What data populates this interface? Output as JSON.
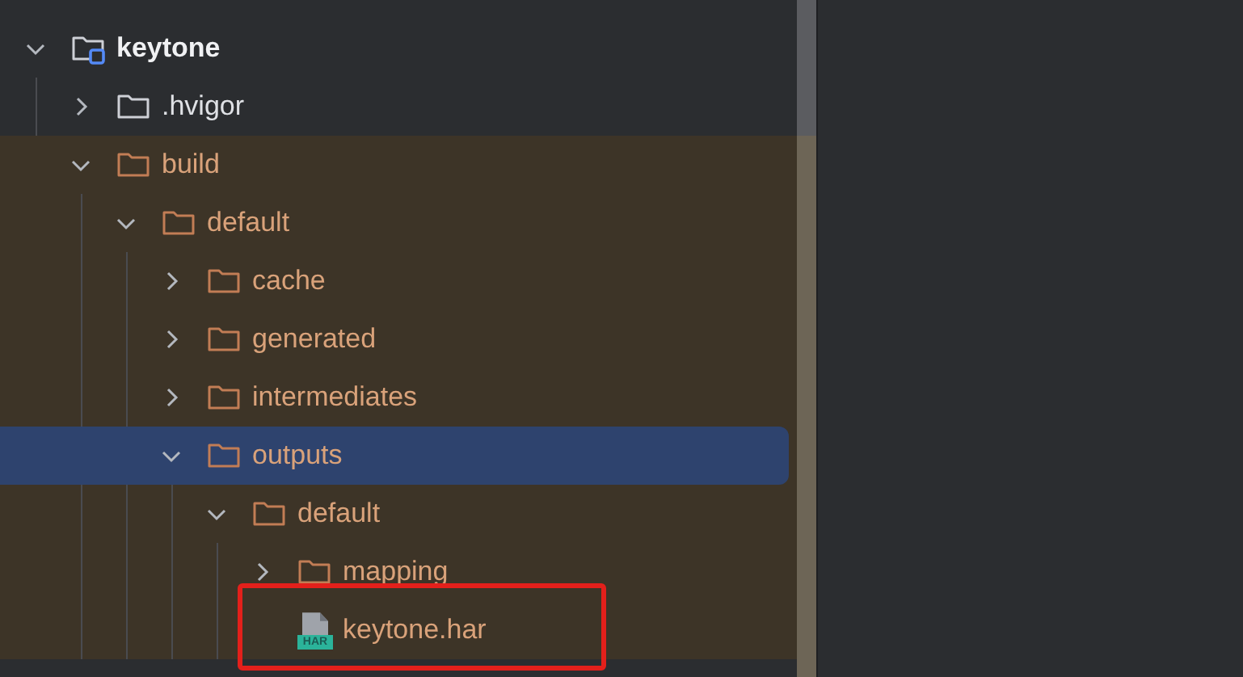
{
  "tree": [
    {
      "label": "keytone",
      "kind": "module",
      "expanded": true,
      "selected": false,
      "children": [
        {
          "label": ".hvigor",
          "kind": "folder",
          "expanded": false,
          "selected": false
        },
        {
          "label": "build",
          "kind": "folder",
          "expanded": true,
          "excluded": true,
          "selected": false,
          "children": [
            {
              "label": "default",
              "kind": "folder",
              "expanded": true,
              "selected": false,
              "children": [
                {
                  "label": "cache",
                  "kind": "folder",
                  "expanded": false,
                  "selected": false
                },
                {
                  "label": "generated",
                  "kind": "folder",
                  "expanded": false,
                  "selected": false
                },
                {
                  "label": "intermediates",
                  "kind": "folder",
                  "expanded": false,
                  "selected": false
                },
                {
                  "label": "outputs",
                  "kind": "folder",
                  "expanded": true,
                  "selected": true,
                  "children": [
                    {
                      "label": "default",
                      "kind": "folder",
                      "expanded": true,
                      "selected": false,
                      "children": [
                        {
                          "label": "mapping",
                          "kind": "folder",
                          "expanded": false,
                          "selected": false
                        },
                        {
                          "label": "keytone.har",
                          "kind": "har",
                          "icon_label": "HAR",
                          "selected": false,
                          "highlighted": true
                        }
                      ]
                    }
                  ]
                }
              ]
            }
          ]
        }
      ]
    }
  ]
}
